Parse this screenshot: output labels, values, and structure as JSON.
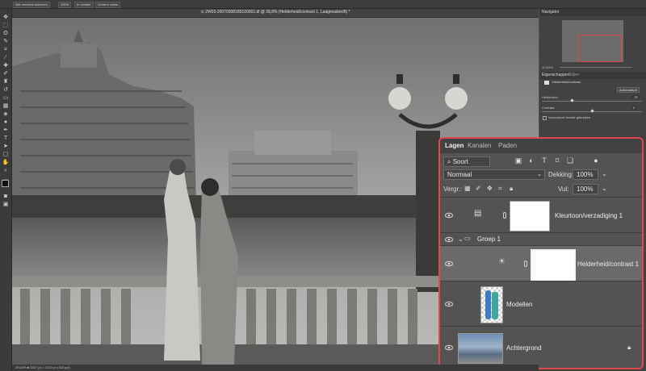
{
  "optionsbar": {
    "move_toggle": "Alle vensters schuiven",
    "zoom": "100%",
    "fit_button": "In venster",
    "fill_button": "Scherm vullen"
  },
  "document": {
    "title": "⊙ 2W03-20070308185100001.tif @ 39,8% (Helderheid/contrast 1, Laagmasker/8) *",
    "status": "39,83%  ■ 3307 px x 2210 px (300 ppi)"
  },
  "navigator": {
    "title": "Navigator",
    "zoom": "39,83%"
  },
  "properties": {
    "tabs": [
      "Eigenschappen",
      "Stijlen"
    ],
    "adjustment_name": "Helderheid/contrast",
    "auto_button": "Automatisch",
    "brightness_label": "Helderheid:",
    "brightness_value": "-75",
    "brightness_pct": 0.3,
    "contrast_label": "Contrast:",
    "contrast_value": "0",
    "contrast_pct": 0.5,
    "legacy_label": "Verouderde functie gebruiken"
  },
  "layers_panel": {
    "tabs": [
      "Lagen",
      "Kanalen",
      "Paden"
    ],
    "filter_kind": "Soort",
    "blend_mode": "Normaal",
    "opacity_label": "Dekking:",
    "opacity_value": "100%",
    "lock_label": "Vergr.:",
    "fill_label": "Vul:",
    "fill_value": "100%",
    "layers": [
      {
        "name": "Kleurtoon/verzadiging 1"
      },
      {
        "name": "Groep 1"
      },
      {
        "name": "Helderheid/contrast 1"
      },
      {
        "name": "Modellen"
      },
      {
        "name": "Achtergrond"
      }
    ]
  },
  "colors": {
    "highlight_border": "#e0484e"
  }
}
